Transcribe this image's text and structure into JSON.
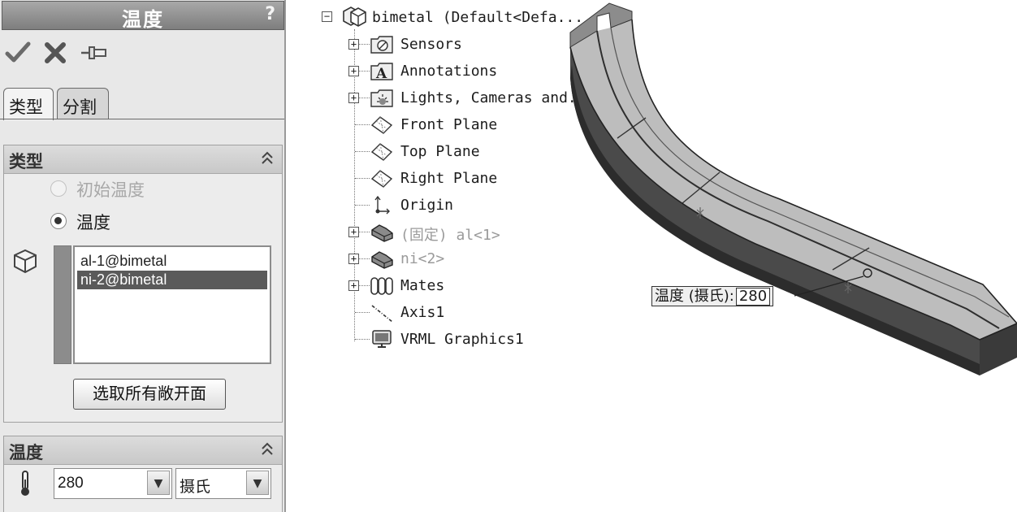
{
  "panel": {
    "title": "温度",
    "help": "?",
    "tabs": [
      "类型",
      "分割"
    ],
    "type_group": {
      "title": "类型",
      "collapse": "⌃",
      "options": [
        {
          "label": "初始温度",
          "selected": false,
          "enabled": false
        },
        {
          "label": "温度",
          "selected": true,
          "enabled": true
        }
      ],
      "faces": [
        "al-1@bimetal",
        "ni-2@bimetal"
      ],
      "selected_face": "ni-2@bimetal",
      "select_button": "选取所有敞开面"
    },
    "temp_group": {
      "title": "温度",
      "collapse": "⌃",
      "value": "280",
      "unit": "摄氏"
    }
  },
  "tree": {
    "root": "bimetal  (Default<Defa...",
    "items": [
      {
        "label": "Sensors",
        "expand": "+",
        "icon": "sensors-icon",
        "grey": false
      },
      {
        "label": "Annotations",
        "expand": "+",
        "icon": "annotations-icon",
        "grey": false
      },
      {
        "label": "Lights, Cameras and...",
        "expand": "+",
        "icon": "lights-folder-icon",
        "grey": false
      },
      {
        "label": "Front Plane",
        "expand": "",
        "icon": "plane-icon",
        "grey": false
      },
      {
        "label": "Top Plane",
        "expand": "",
        "icon": "plane-icon",
        "grey": false
      },
      {
        "label": "Right Plane",
        "expand": "",
        "icon": "plane-icon",
        "grey": false
      },
      {
        "label": "Origin",
        "expand": "",
        "icon": "origin-icon",
        "grey": false
      },
      {
        "label": "(固定) al<1>",
        "expand": "+",
        "icon": "part-icon",
        "grey": true
      },
      {
        "label": "ni<2>",
        "expand": "+",
        "icon": "part-icon",
        "grey": true
      },
      {
        "label": "Mates",
        "expand": "+",
        "icon": "mates-icon",
        "grey": false
      },
      {
        "label": "Axis1",
        "expand": "",
        "icon": "axis-icon",
        "grey": false
      },
      {
        "label": "VRML Graphics1",
        "expand": "",
        "icon": "vrml-monitor-icon",
        "grey": false
      }
    ]
  },
  "callout": {
    "label": "温度 (摄氏):",
    "value": "280"
  }
}
